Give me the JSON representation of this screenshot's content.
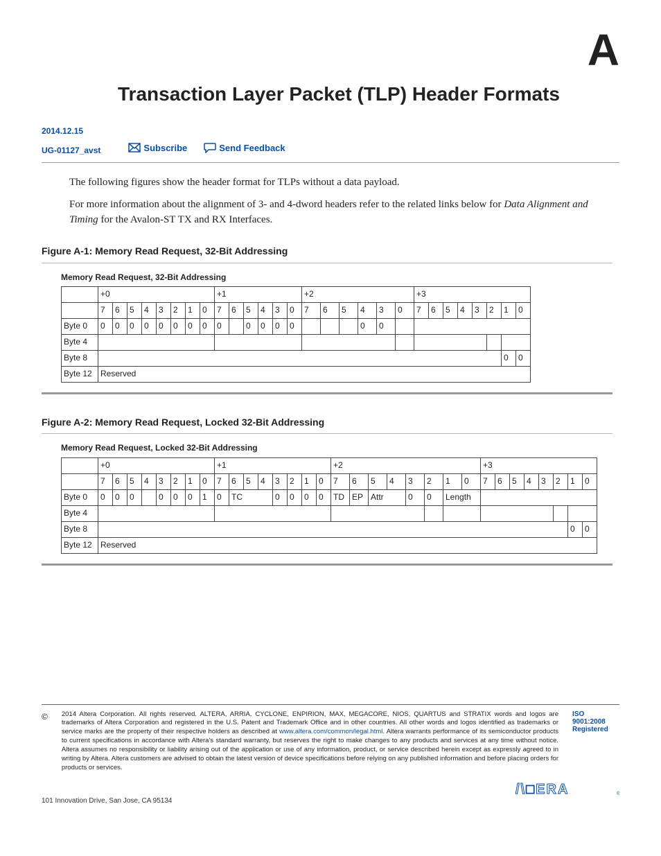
{
  "header": {
    "title": "Transaction Layer Packet (TLP) Header Formats",
    "letter": "A",
    "date": "2014.12.15",
    "ug": "UG-01127_avst",
    "subscribe": "Subscribe",
    "feedback": "Send Feedback"
  },
  "paras": {
    "p1": "The following figures show the header format for TLPs without a data payload.",
    "p2a": "For more information about the alignment of 3- and 4-dword headers refer to the related links below for ",
    "p2i": "Data Alignment and Timing",
    "p2b": " for the Avalon-ST TX and RX Interfaces."
  },
  "fig1": {
    "label": "Figure A-1: Memory Read Request, 32-Bit Addressing",
    "caption": "Memory Read Request, 32-Bit Addressing",
    "offsets": [
      "+0",
      "+1",
      "+2",
      "+3"
    ],
    "bits0": [
      "7",
      "6",
      "5",
      "4",
      "3",
      "2",
      "1",
      "0"
    ],
    "bits1": [
      "7",
      "6",
      "5",
      "4",
      "3",
      "2",
      "1",
      "0"
    ],
    "bits2": [
      "7",
      "6",
      "5",
      "4",
      "3",
      "2",
      "1",
      "0"
    ],
    "bits3": [
      "7",
      "6",
      "5",
      "4",
      "3",
      "2",
      "1",
      "0"
    ],
    "byte0": {
      "label": "Byte 0",
      "c0": [
        "0",
        "0",
        "0",
        "0",
        "0",
        "0",
        "0",
        "0"
      ],
      "c1": [
        "0",
        "",
        "0",
        "0",
        "0",
        "0"
      ],
      "c2": [
        "",
        "",
        "",
        "0",
        "0",
        ""
      ],
      "c3": ""
    },
    "byte4": {
      "label": "Byte 4"
    },
    "byte8": {
      "label": "Byte 8",
      "tail": [
        "0",
        "0"
      ]
    },
    "byte12": {
      "label": "Byte 12",
      "reserved": "Reserved"
    }
  },
  "fig2": {
    "label": "Figure A-2: Memory Read Request, Locked 32-Bit Addressing",
    "caption": "Memory Read Request, Locked 32-Bit Addressing",
    "offsets": [
      "+0",
      "+1",
      "+2",
      "+3"
    ],
    "bits0": [
      "7",
      "6",
      "5",
      "4",
      "3",
      "2",
      "1",
      "0"
    ],
    "bits1": [
      "7",
      "6",
      "5",
      "4",
      "3",
      "2",
      "1",
      "0"
    ],
    "bits2": [
      "7",
      "6",
      "5",
      "4",
      "3",
      "2",
      "1",
      "0"
    ],
    "bits3": [
      "7",
      "6",
      "5",
      "4",
      "3",
      "2",
      "1",
      "0"
    ],
    "byte0": {
      "label": "Byte 0",
      "c0": [
        "0",
        "0",
        "0",
        "",
        "0",
        "0",
        "0",
        "1"
      ],
      "c1": [
        "0",
        "TC",
        "0",
        "0",
        "0",
        "0"
      ],
      "c2": [
        "TD",
        "EP",
        "Attr",
        "0",
        "0",
        "Length"
      ],
      "c3": ""
    },
    "byte4": {
      "label": "Byte 4"
    },
    "byte8": {
      "label": "Byte 8",
      "tail": [
        "0",
        "0"
      ]
    },
    "byte12": {
      "label": "Byte 12",
      "reserved": "Reserved"
    }
  },
  "legal": {
    "copyright": "©",
    "text1": "2014 Altera Corporation. All rights reserved. ALTERA, ARRIA, CYCLONE, ENPIRION, MAX, MEGACORE, NIOS, QUARTUS and STRATIX words and logos are trademarks of Altera Corporation and registered in the U.S. Patent and Trademark Office and in other countries. All other words and logos identified as trademarks or service marks are the property of their respective holders as described at ",
    "link": "www.altera.com/common/legal.html",
    "text2": ". Altera warrants performance of its semiconductor products to current specifications in accordance with Altera's standard warranty, but reserves the right to make changes to any products and services at any time without notice. Altera assumes no responsibility or liability arising out of the application or use of any information, product, or service described herein except as expressly agreed to in writing by Altera. Altera customers are advised to obtain the latest version of device specifications before relying on any published information and before placing orders for products or services.",
    "iso1": "ISO",
    "iso2": "9001:2008",
    "iso3": "Registered",
    "address": "101 Innovation Drive, San Jose, CA 95134",
    "logo": "ALTERA"
  }
}
